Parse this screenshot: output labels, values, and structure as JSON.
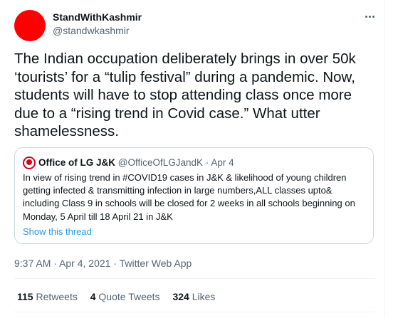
{
  "tweet": {
    "author_name": "StandWithKashmir",
    "author_handle": "@standwkashmir",
    "avatar_color": "#ff0000",
    "more_icon": "more-horizontal-icon",
    "text": "The Indian occupation deliberately brings in over 50k ‘tourists’ for a “tulip festival” during a pandemic. Now, students will have to stop attending class once more due to a “rising trend in Covid case.” What utter shamelessness.",
    "time": "9:37 AM",
    "date": "Apr 4, 2021",
    "separator": "·",
    "app": "Twitter Web App"
  },
  "quote": {
    "name": "Office of LG J&K",
    "handle": "@OfficeOfLGJandK",
    "separator": "·",
    "date": "Apr 4",
    "text": "In view of rising trend in #COVID19 cases in J&K & likelihood of young children getting infected & transmitting infection in large numbers,ALL classes upto& including Class 9 in schools will be closed for 2 weeks in all schools beginning on Monday, 5 April till 18 April 21 in J&K",
    "show_thread": "Show this thread",
    "avatar_color": "#d5001c"
  },
  "stats": {
    "retweets_count": "115",
    "retweets_label": "Retweets",
    "quotes_count": "4",
    "quotes_label": "Quote Tweets",
    "likes_count": "324",
    "likes_label": "Likes"
  },
  "colors": {
    "link": "#1d9bf0",
    "secondary_text": "#536471",
    "border": "#cfd9de"
  }
}
